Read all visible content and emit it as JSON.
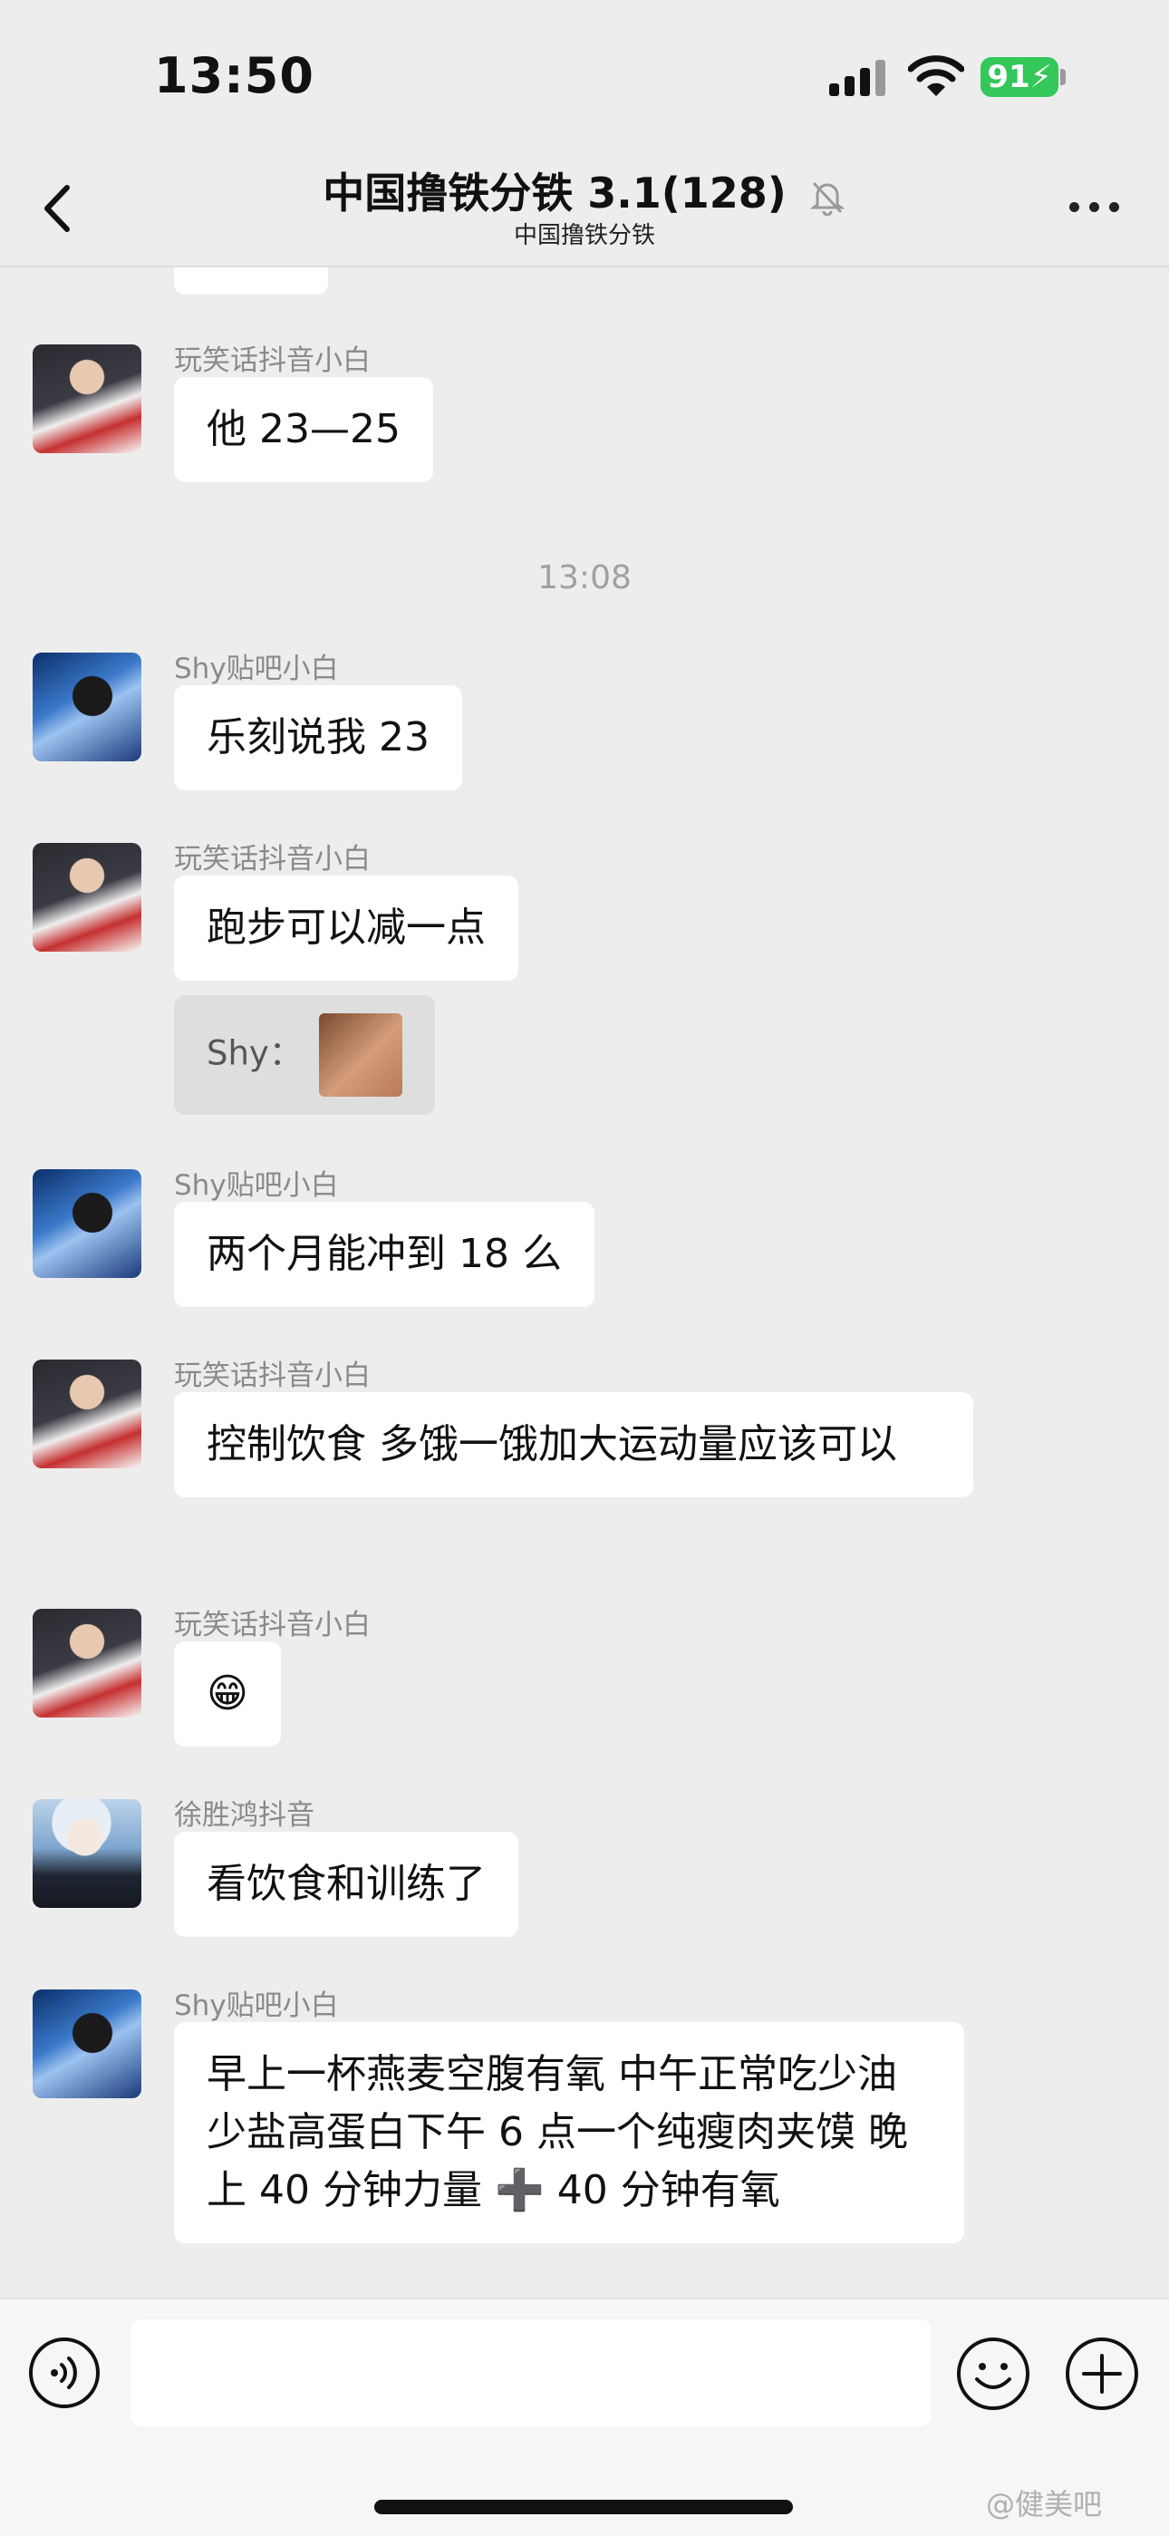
{
  "status_bar": {
    "time": "13:50",
    "battery": "91"
  },
  "nav": {
    "title": "中国撸铁分铁 3.1(128)",
    "subtitle": "中国撸铁分铁"
  },
  "messages": [
    {
      "sender": "玩笑话抖音小白",
      "text": "他 23—25"
    },
    {
      "sender": "Shy贴吧小白",
      "text": "乐刻说我 23"
    },
    {
      "sender": "玩笑话抖音小白",
      "text": "跑步可以减一点",
      "quote_label": "Shy："
    },
    {
      "sender": "Shy贴吧小白",
      "text": "两个月能冲到 18 么"
    },
    {
      "sender": "玩笑话抖音小白",
      "text": "控制饮食  多饿一饿加大运动量应该可以"
    },
    {
      "sender": "玩笑话抖音小白",
      "text": "😁"
    },
    {
      "sender": "徐胜鸿抖音",
      "text": "看饮食和训练了"
    },
    {
      "sender": "Shy贴吧小白",
      "text": "早上一杯燕麦空腹有氧 中午正常吃少油少盐高蛋白下午 6 点一个纯瘦肉夹馍 晚上 40 分钟力量 ➕ 40 分钟有氧"
    }
  ],
  "time_divider": "13:08",
  "watermark": "@健美吧"
}
